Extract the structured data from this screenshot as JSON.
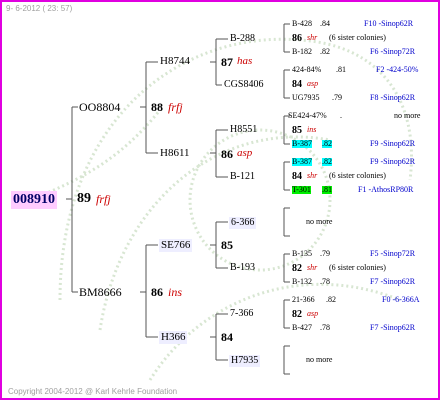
{
  "date": "9- 6-2012 ( 23: 57)",
  "copyright": "Copyright 2004-2012 @ Karl Kehrle Foundation",
  "root": {
    "name": "008910",
    "num": "89",
    "tag": "frfj"
  },
  "gen1": [
    {
      "name": "OO8804",
      "num": "88",
      "tag": "frfj"
    },
    {
      "name": "BM8666",
      "num": "86",
      "tag": "ins"
    }
  ],
  "gen2": [
    {
      "name": "H8744",
      "num": "87",
      "tag": "has"
    },
    {
      "name": "H8611",
      "num": "86",
      "tag": "asp"
    },
    {
      "name": "SE766",
      "num": "85",
      "tag": ""
    },
    {
      "name": "H366",
      "num": "84",
      "tag": ""
    }
  ],
  "gen3": [
    {
      "name": "B-288",
      "num": "86",
      "tag": "shr",
      "note": "(6 sister colonies)"
    },
    {
      "name": "CGS8406",
      "num": "84",
      "tag": "asp",
      "note": ""
    },
    {
      "name": "H8551",
      "num": "85",
      "tag": "ins",
      "note": ""
    },
    {
      "name": "B-121",
      "num": "84",
      "tag": "shr",
      "note": "(6 sister colonies)"
    },
    {
      "name": "6-366",
      "num": "",
      "tag": "",
      "note": ""
    },
    {
      "name": "B-193",
      "num": "82",
      "tag": "shr",
      "note": "(6 sister colonies)"
    },
    {
      "name": "7-366",
      "num": "82",
      "tag": "asp",
      "note": ""
    },
    {
      "name": "H7935",
      "num": "",
      "tag": "",
      "note": ""
    }
  ],
  "gen4": [
    {
      "name": "B-428",
      "val": ".84",
      "src": "F10 -Sinop62R"
    },
    {
      "name": "B-182",
      "val": ".82",
      "src": "F6 -Sinop72R"
    },
    {
      "name": "424-84%",
      "val": ".81",
      "src": "F2 -424-50%"
    },
    {
      "name": "UG7935",
      "val": ".79",
      "src": "F8 -Sinop62R"
    },
    {
      "name": "SE424-47%",
      "val": ".",
      "src": "no more"
    },
    {
      "name": "B-387",
      "val": ".82",
      "src": "F9 -Sinop62R"
    },
    {
      "name": "B-387",
      "val": ".82",
      "src": "F9 -Sinop62R"
    },
    {
      "name": "T-301",
      "val": ".81",
      "src": "F1 -AthosRP80R"
    },
    {
      "name": "no more",
      "val": "",
      "src": ""
    },
    {
      "name": "B-135",
      "val": ".79",
      "src": "F5 -Sinop72R"
    },
    {
      "name": "B-132",
      "val": ".78",
      "src": "F7 -Sinop62R"
    },
    {
      "name": "21-366",
      "val": ".82",
      "src": "F0 -6-366A"
    },
    {
      "name": "B-427",
      "val": ".78",
      "src": "F7 -Sinop62R"
    },
    {
      "name": "no more",
      "val": "",
      "src": ""
    }
  ],
  "colors": {
    "frame": "#e000e0",
    "root_bg": "#ffccff",
    "cyan": "#00ffff",
    "green": "#00ee00",
    "tag": "#cc0000",
    "src": "#0000cc"
  }
}
